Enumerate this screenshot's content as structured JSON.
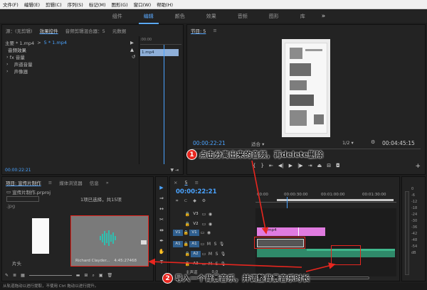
{
  "menu": [
    "文件(F)",
    "编辑(E)",
    "剪辑(C)",
    "序列(S)",
    "标记(M)",
    "图形(G)",
    "窗口(W)",
    "帮助(H)"
  ],
  "workspaces": [
    "组件",
    "编辑",
    "颜色",
    "效果",
    "音频",
    "图形",
    "库"
  ],
  "effects_panel": {
    "tabs": [
      "源：(无剪辑)",
      "效果控件",
      "音频剪辑混合器：5",
      "元数据"
    ],
    "master": "主要 * 1.mp4",
    "clip": "5 * 1.mp4",
    "section": "音频效果",
    "items": [
      "fx 音量",
      "声道音量",
      "声像器"
    ],
    "mini_clip": "1.mp4",
    "time": "00:00:22:21"
  },
  "program": {
    "title": "节目: 5",
    "timecode": "00:00:22:21",
    "fit": "适合",
    "scale": "1/2",
    "duration": "00:04:45:15"
  },
  "project": {
    "tabs": [
      "项目: 宣传片制作",
      "媒体浏览器",
      "信息"
    ],
    "file": "宣传片制作.prproj",
    "selection": "1项已选择，共15项",
    "thumb_label": "片头",
    "clip_name": "Richard Clayder...",
    "clip_duration": "4:45:27468",
    "jpg": ".jpg"
  },
  "timeline": {
    "title": "5",
    "timecode": "00:00:22:21",
    "ruler": [
      "00:00",
      "00:00:30:00",
      "00:01:00:00",
      "00:01:30:00"
    ],
    "tracks": [
      "V3",
      "V2",
      "V1",
      "A1",
      "A2",
      "A3"
    ],
    "master": "主声道",
    "master_val": "0.0",
    "video_clip": "1.mp4",
    "meter_scale": [
      "0",
      "-6",
      "-12",
      "-18",
      "-24",
      "-30",
      "-36",
      "-42",
      "-48",
      "-54",
      "dB"
    ]
  },
  "status": "从轨道拖动以进行提取，不使用 Ctrl 拖动以进行提升。",
  "callouts": {
    "one_num": "1",
    "one_text": "点击分离出来的音频，再delete删除",
    "two_num": "2",
    "two_text": "导入一个背景音乐，并调整背景音乐时长"
  },
  "colors": {
    "accent": "#4aa3ff",
    "video_clip": "#e07be0",
    "audio_clip": "#2f8a6a",
    "annotation": "#e8261f"
  }
}
